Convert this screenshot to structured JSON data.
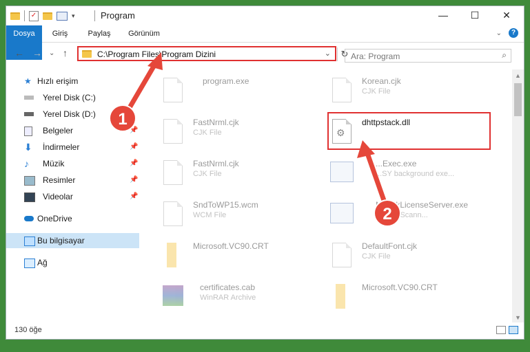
{
  "window": {
    "title": "Program"
  },
  "ribbon": {
    "tabs": [
      "Dosya",
      "Giriş",
      "Paylaş",
      "Görünüm"
    ]
  },
  "nav": {
    "address_path": "C:\\Program Files\\Program Dizini",
    "search_placeholder": "Ara: Program"
  },
  "sidebar": {
    "items": [
      {
        "label": "Hızlı erişim",
        "icon": "star-icon"
      },
      {
        "label": "Yerel Disk (C:)",
        "icon": "disk-icon"
      },
      {
        "label": "Yerel Disk (D:)",
        "icon": "disk-icon"
      },
      {
        "label": "Belgeler",
        "icon": "documents-icon"
      },
      {
        "label": "İndirmeler",
        "icon": "download-icon"
      },
      {
        "label": "Müzik",
        "icon": "music-icon"
      },
      {
        "label": "Resimler",
        "icon": "pictures-icon"
      },
      {
        "label": "Videolar",
        "icon": "videos-icon"
      },
      {
        "label": "OneDrive",
        "icon": "cloud-icon"
      },
      {
        "label": "Bu bilgisayar",
        "icon": "computer-icon"
      },
      {
        "label": "Ağ",
        "icon": "network-icon"
      }
    ]
  },
  "files": [
    {
      "name": "program.exe",
      "type": ""
    },
    {
      "name": "Korean.cjk",
      "type": "CJK File"
    },
    {
      "name": "FastNrml.cjk",
      "type": "CJK File"
    },
    {
      "name": "dhttpstack.dll",
      "type": ""
    },
    {
      "name": "FastNrml.cjk",
      "type": "CJK File"
    },
    {
      "name": "...Exec.exe",
      "type": "...SY background exe..."
    },
    {
      "name": "SndToWP15.wcm",
      "type": "WCM File"
    },
    {
      "name": "Ne...rkLicenseServer.exe",
      "type": "...work Scann..."
    },
    {
      "name": "Microsoft.VC90.CRT",
      "type": ""
    },
    {
      "name": "DefaultFont.cjk",
      "type": "CJK File"
    },
    {
      "name": "certificates.cab",
      "type": "WinRAR Archive"
    },
    {
      "name": "Microsoft.VC90.CRT",
      "type": ""
    }
  ],
  "status": {
    "count": "130 öğe"
  },
  "annotations": {
    "step1": "1",
    "step2": "2",
    "color": "#e5473a"
  },
  "colors": {
    "accent": "#1979ca",
    "highlight": "#e03030",
    "selected": "#cce4f7"
  }
}
